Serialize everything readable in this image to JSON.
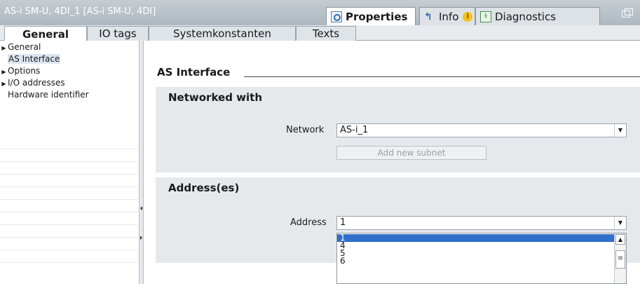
{
  "window": {
    "title": "AS-i SM-U, 4DI_1 [AS-i SM-U, 4DI]"
  },
  "inspector_tabs": [
    {
      "label": "Properties",
      "icon": "properties-icon",
      "active": true
    },
    {
      "label": "Info",
      "icon": "info-icon",
      "badge": "i",
      "active": false
    },
    {
      "label": "Diagnostics",
      "icon": "diagnostics-icon",
      "active": false
    }
  ],
  "sub_tabs": [
    {
      "label": "General",
      "active": true
    },
    {
      "label": "IO tags",
      "active": false
    },
    {
      "label": "Systemkonstanten",
      "active": false
    },
    {
      "label": "Texts",
      "active": false
    }
  ],
  "nav": {
    "items": [
      {
        "label": "General",
        "expandable": true,
        "selected": false
      },
      {
        "label": "AS Interface",
        "expandable": false,
        "selected": true
      },
      {
        "label": "Options",
        "expandable": true,
        "selected": false
      },
      {
        "label": "I/O addresses",
        "expandable": true,
        "selected": false
      },
      {
        "label": "Hardware identifier",
        "expandable": false,
        "selected": false
      }
    ]
  },
  "content": {
    "section_title": "AS Interface",
    "networked_group": {
      "title": "Networked with",
      "network_label": "Network",
      "network_value": "AS-i_1",
      "add_subnet_label": "Add new subnet"
    },
    "address_group": {
      "title": "Address(es)",
      "address_label": "Address",
      "address_value": "1",
      "options": [
        "1",
        "4",
        "5",
        "6"
      ],
      "selected_option": "1"
    }
  },
  "colors": {
    "titlebar": "#b7c0c8",
    "group_bg": "#e6e9ec",
    "selection": "#2f6fc9"
  }
}
